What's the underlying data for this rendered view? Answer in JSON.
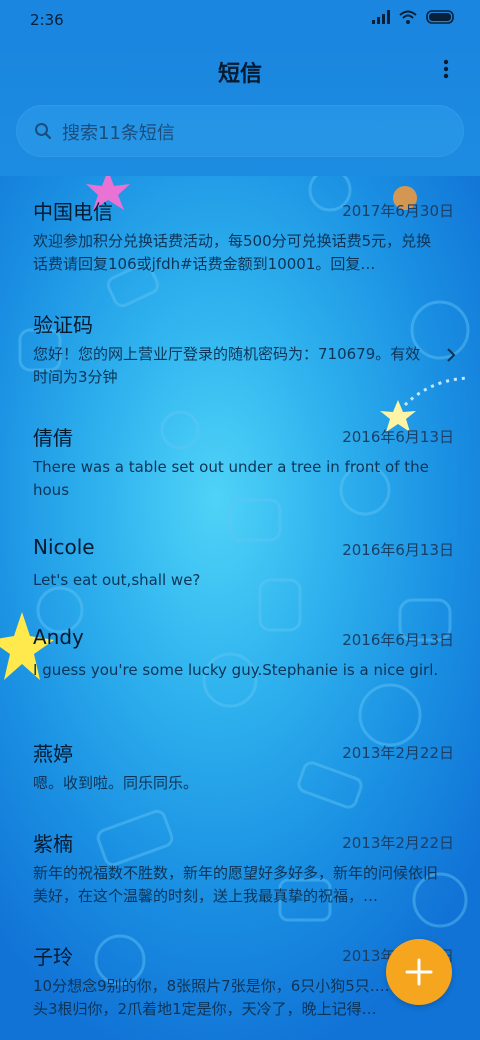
{
  "status_bar": {
    "time": "2:36",
    "icons": [
      "signal-icon",
      "wifi-icon",
      "battery-icon"
    ]
  },
  "header": {
    "title": "短信",
    "more_icon": "more-vert-icon"
  },
  "search": {
    "placeholder": "搜索11条短信",
    "icon": "search-icon"
  },
  "conversations": [
    {
      "name": "中国电信",
      "date": "2017年6月30日",
      "preview": "欢迎参加积分兑换话费活动，每500分可兑换话费5元，兑换话费请回复106或jfdh#话费金额到10001。回复…"
    },
    {
      "name": "验证码",
      "date": "",
      "preview": "您好！您的网上营业厅登录的随机密码为：710679。有效时间为3分钟"
    },
    {
      "name": "倩倩",
      "date": "2016年6月13日",
      "preview": "There was a table set out under a tree in front of the hous"
    },
    {
      "name": "Nicole",
      "date": "2016年6月13日",
      "preview": "Let's eat out,shall we?"
    },
    {
      "name": "Andy",
      "date": "2016年6月13日",
      "preview": "I guess you're some lucky guy.Stephanie is a nice girl."
    },
    {
      "name": "燕婷",
      "date": "2013年2月22日",
      "preview": "嗯。收到啦。同乐同乐。"
    },
    {
      "name": "紫楠",
      "date": "2013年2月22日",
      "preview": "新年的祝福数不胜数，新年的愿望好多好多，新年的问候依旧美好，在这个温馨的时刻，送上我最真挚的祝福，…"
    },
    {
      "name": "子玲",
      "date": "2013年2月22日",
      "preview": "10分想念9别的你，8张照片7张是你，6只小狗5只……4根骨头3根归你，2爪着地1定是你，天冷了，晚上记得…"
    }
  ],
  "fab": {
    "icon": "plus-icon"
  },
  "colors": {
    "accent": "#f6a51e",
    "background": "#1a8fe2",
    "header": "#1b86df"
  }
}
